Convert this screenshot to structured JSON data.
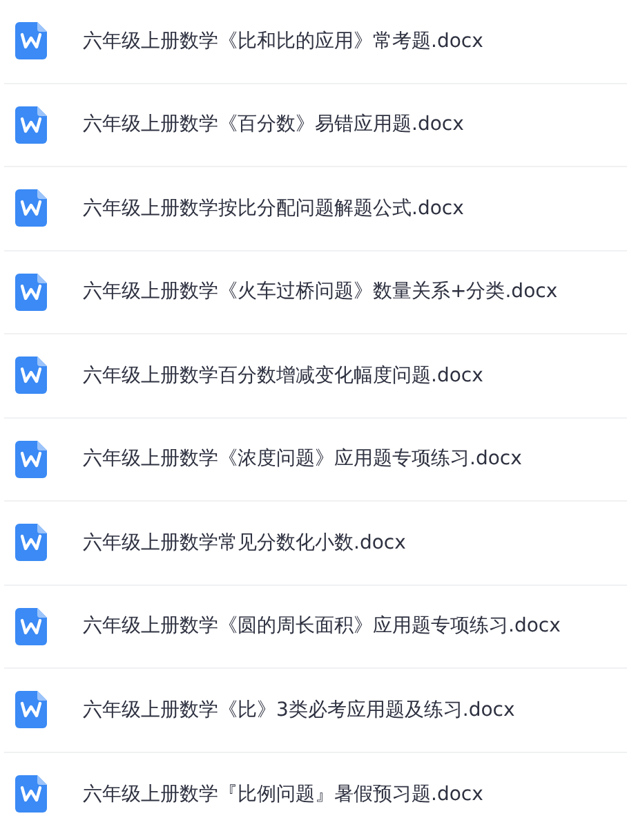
{
  "files": [
    {
      "name": "六年级上册数学《比和比的应用》常考题.docx",
      "kind": "word"
    },
    {
      "name": "六年级上册数学《百分数》易错应用题.docx",
      "kind": "word"
    },
    {
      "name": "六年级上册数学按比分配问题解题公式.docx",
      "kind": "word"
    },
    {
      "name": "六年级上册数学《火车过桥问题》数量关系+分类.docx",
      "kind": "word"
    },
    {
      "name": "六年级上册数学百分数增减变化幅度问题.docx",
      "kind": "word"
    },
    {
      "name": "六年级上册数学《浓度问题》应用题专项练习.docx",
      "kind": "word"
    },
    {
      "name": "六年级上册数学常见分数化小数.docx",
      "kind": "word"
    },
    {
      "name": "六年级上册数学《圆的周长面积》应用题专项练习.docx",
      "kind": "word"
    },
    {
      "name": "六年级上册数学《比》3类必考应用题及练习.docx",
      "kind": "word"
    },
    {
      "name": "六年级上册数学『比例问题』暑假预习题.docx",
      "kind": "word"
    }
  ]
}
